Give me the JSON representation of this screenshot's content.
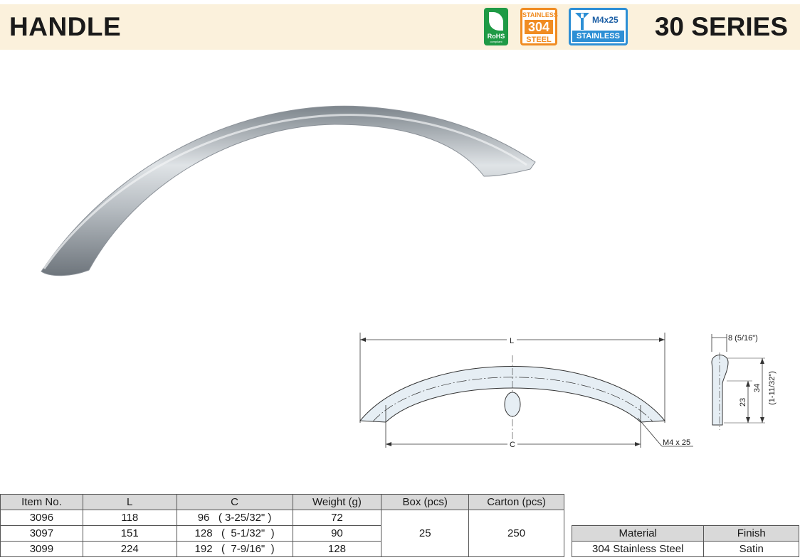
{
  "header": {
    "title": "HANDLE",
    "series": "30 SERIES"
  },
  "badges": {
    "rohs": {
      "label": "RoHS",
      "sublabel": "compliant",
      "color": "#1f9a45"
    },
    "steel": {
      "line1": "STAINLESS",
      "line2": "304",
      "line3": "STEEL",
      "color": "#f08c22"
    },
    "screw": {
      "size": "M4x25",
      "label": "STAINLESS",
      "color": "#2d8fd5",
      "icon": "screw-icon"
    }
  },
  "drawing": {
    "length_label": "L",
    "center_label": "C",
    "screw_label": "M4 x 25",
    "width_label": "8 (5/16\")",
    "height_inner": "23",
    "height_total": "34",
    "height_total_in": "(1-11/32\")"
  },
  "spec_table": {
    "headers": [
      "Item No.",
      "L",
      "C",
      "Weight (g)",
      "Box (pcs)",
      "Carton (pcs)"
    ],
    "rows": [
      {
        "item": "3096",
        "l": "118",
        "c": "96   ( 3-25/32\" )",
        "weight": "72"
      },
      {
        "item": "3097",
        "l": "151",
        "c": "128   (  5-1/32\"  )",
        "weight": "90"
      },
      {
        "item": "3099",
        "l": "224",
        "c": "192   (  7-9/16\"  )",
        "weight": "128"
      }
    ],
    "box": "25",
    "carton": "250"
  },
  "material_table": {
    "headers": [
      "Material",
      "Finish"
    ],
    "material": "304 Stainless Steel",
    "finish": "Satin"
  }
}
